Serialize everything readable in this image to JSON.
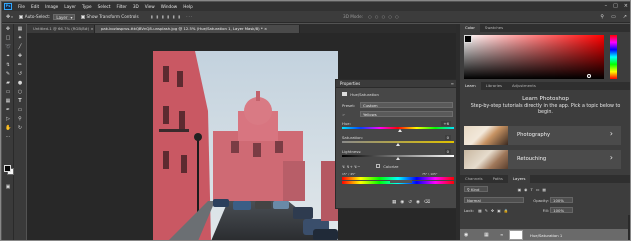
{
  "app": {
    "logo": "Ps",
    "menu": [
      "File",
      "Edit",
      "Image",
      "Layer",
      "Type",
      "Select",
      "Filter",
      "3D",
      "View",
      "Window",
      "Help"
    ]
  },
  "options_bar": {
    "auto_select_label": "Auto-Select:",
    "auto_select_value": "Layer",
    "show_transform_label": "Show Transform Controls",
    "more": "···",
    "mode_3d": "3D Mode:"
  },
  "tabs": [
    {
      "label": "Untitled-1 @ 66.7% (RGB/8#) ×"
    },
    {
      "label": "pak-kozlasprus-ttkQBVnQ8-unsplash.jpg @ 12.5% (Hue/Saturation 1, Layer Mask/8) * ×"
    }
  ],
  "properties": {
    "title": "Properties",
    "subtitle": "Hue/Saturation",
    "preset_label": "Preset:",
    "preset_value": "Custom",
    "channel_value": "Yellows",
    "hue_label": "Hue:",
    "hue_value": "+6",
    "saturation_label": "Saturation:",
    "saturation_value": "0",
    "lightness_label": "Lightness:",
    "lightness_value": "0",
    "colorize_label": "Colorize",
    "range_left": "15° / 45°",
    "range_right": "75° \\ 105°",
    "hue_fraction": 0.52,
    "saturation_fraction": 0.5,
    "lightness_fraction": 0.5
  },
  "color_panel": {
    "tabs": [
      "Color",
      "Swatches"
    ],
    "foreground": "#000000",
    "background": "#ffffff"
  },
  "learn_panel": {
    "tabs": [
      "Learn",
      "Libraries",
      "Adjustments"
    ],
    "title": "Learn Photoshop",
    "subtitle": "Step-by-step tutorials directly in the app. Pick a topic below to begin.",
    "cards": [
      {
        "label": "Photography"
      },
      {
        "label": "Retouching"
      }
    ]
  },
  "layers_panel": {
    "tabs": [
      "Channels",
      "Paths",
      "Layers"
    ],
    "kind_label": "Kind",
    "blend_mode": "Normal",
    "opacity_label": "Opacity:",
    "opacity_value": "100%",
    "lock_label": "Lock:",
    "fill_label": "Fill:",
    "fill_value": "100%",
    "layer_name": "Hue/Saturation 1"
  },
  "colors": {
    "building": "#d46b73",
    "sky": "#cfd9e0",
    "ui_dark": "#323232",
    "accent_blue": "#31a8ff"
  }
}
